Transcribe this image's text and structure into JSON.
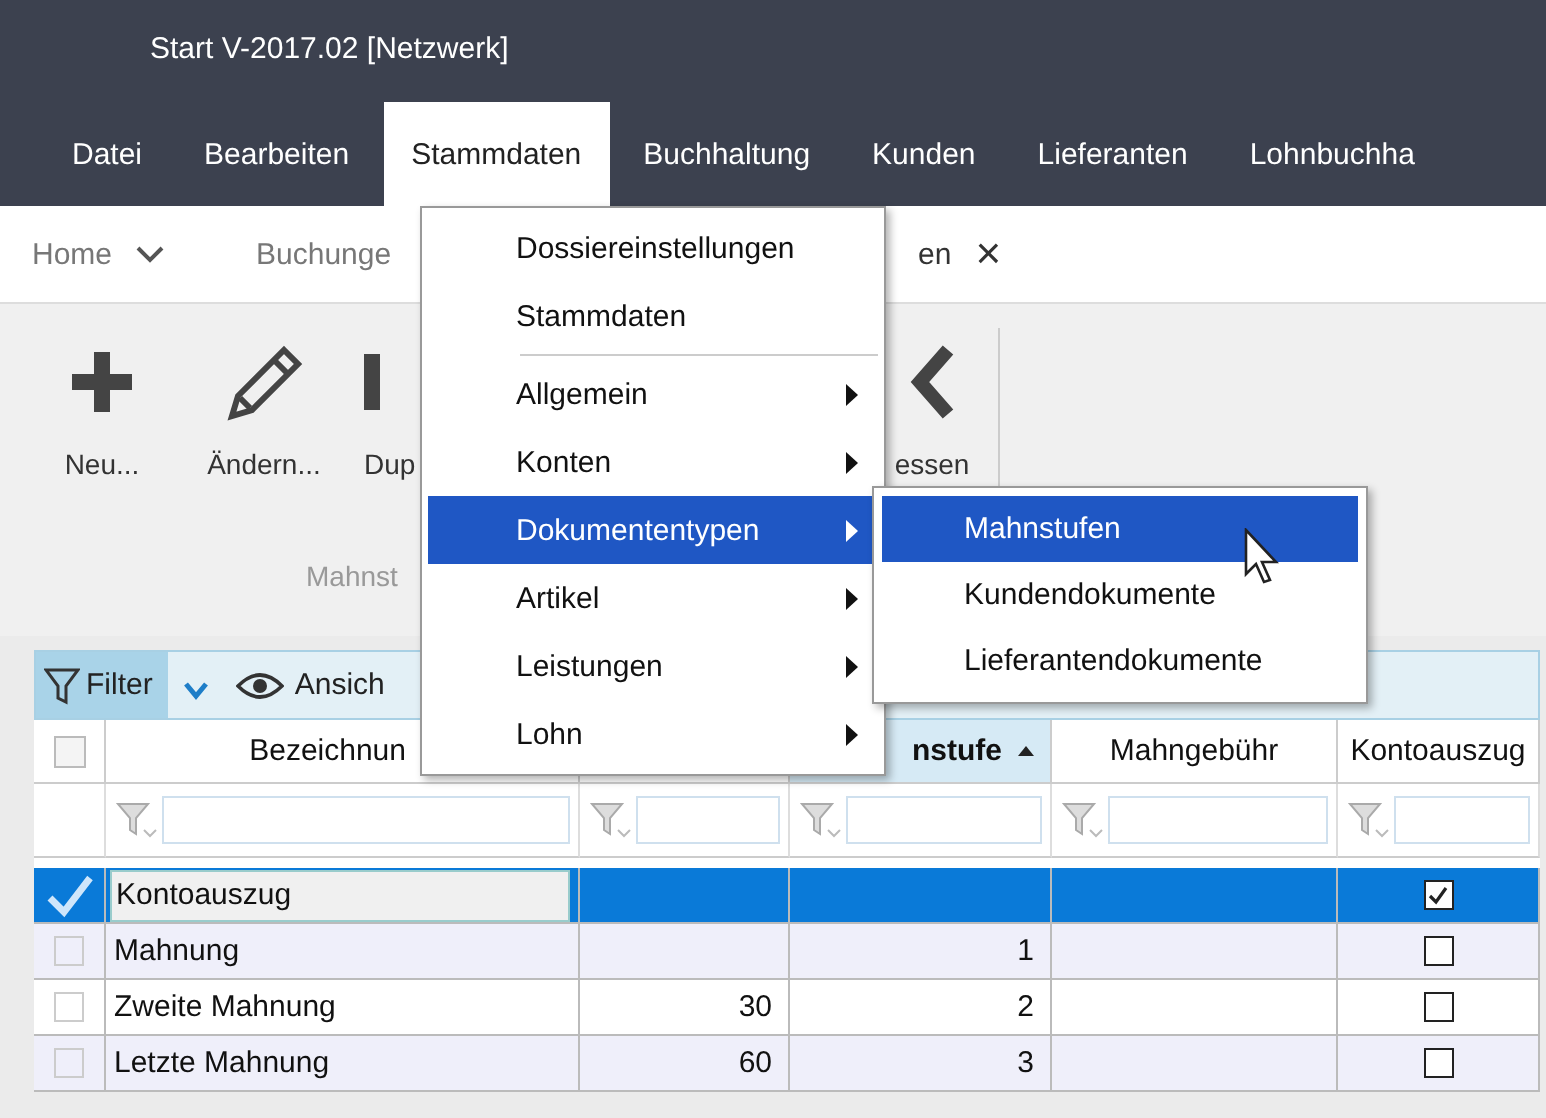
{
  "window": {
    "title": "Start V-2017.02 [Netzwerk]"
  },
  "menubar": [
    {
      "label": "Datei",
      "selected": false
    },
    {
      "label": "Bearbeiten",
      "selected": false
    },
    {
      "label": "Stammdaten",
      "selected": true
    },
    {
      "label": "Buchhaltung",
      "selected": false
    },
    {
      "label": "Kunden",
      "selected": false
    },
    {
      "label": "Lieferanten",
      "selected": false
    },
    {
      "label": "Lohnbuchha",
      "selected": false
    }
  ],
  "tabs": [
    {
      "label": "Home",
      "selected": false,
      "dropdown": true,
      "closable": false
    },
    {
      "label": "Buchunge",
      "selected": false,
      "dropdown": false,
      "closable": false
    },
    {
      "label": "en",
      "selected": true,
      "dropdown": false,
      "closable": true
    }
  ],
  "tab_close": "×",
  "ribbon": {
    "buttons": [
      {
        "label": "Neu..."
      },
      {
        "label": "Ändern..."
      },
      {
        "label": "Dup"
      },
      {
        "label": "essen"
      }
    ],
    "group_label": "Mahnst"
  },
  "grid_toolbar": {
    "filter": {
      "label": "Filter",
      "selected": true
    },
    "view": {
      "label": "Ansich"
    }
  },
  "table": {
    "select_all_checked": false,
    "columns": [
      {
        "label": "Bezeichnun",
        "sorted": false
      },
      {
        "sorted": false
      },
      {
        "label": "nstufe",
        "sorted": true
      },
      {
        "label": "Mahngebühr",
        "sorted": false
      },
      {
        "label": "Kontoauszug",
        "sorted": false
      }
    ],
    "rows": [
      {
        "selected": true,
        "name": "Kontoauszug",
        "kontoauszug": true
      },
      {
        "selected": false,
        "name": "Mahnung",
        "mahnstufe": "1",
        "kontoauszug": false
      },
      {
        "selected": false,
        "name": "Zweite Mahnung",
        "column_2": "30",
        "mahnstufe": "2",
        "kontoauszug": false
      },
      {
        "selected": false,
        "name": "Letzte Mahnung",
        "column_2": "60",
        "mahnstufe": "3",
        "kontoauszug": false
      }
    ]
  },
  "menu": {
    "items": [
      {
        "kind": "item",
        "label": "Dossiereinstellungen",
        "submenu": false,
        "selected": false
      },
      {
        "kind": "item",
        "label": "Stammdaten",
        "submenu": false,
        "selected": false
      },
      {
        "kind": "separator"
      },
      {
        "kind": "item",
        "label": "Allgemein",
        "submenu": true,
        "selected": false
      },
      {
        "kind": "item",
        "label": "Konten",
        "submenu": true,
        "selected": false
      },
      {
        "kind": "item",
        "label": "Dokumententypen",
        "submenu": true,
        "selected": true
      },
      {
        "kind": "item",
        "label": "Artikel",
        "submenu": true,
        "selected": false
      },
      {
        "kind": "item",
        "label": "Leistungen",
        "submenu": true,
        "selected": false
      },
      {
        "kind": "item",
        "label": "Lohn",
        "submenu": true,
        "selected": false
      }
    ]
  },
  "submenu": {
    "items": [
      {
        "label": "Mahnstufen",
        "selected": true
      },
      {
        "label": "Kundendokumente",
        "selected": false
      },
      {
        "label": "Lieferantendokumente",
        "selected": false
      }
    ]
  }
}
